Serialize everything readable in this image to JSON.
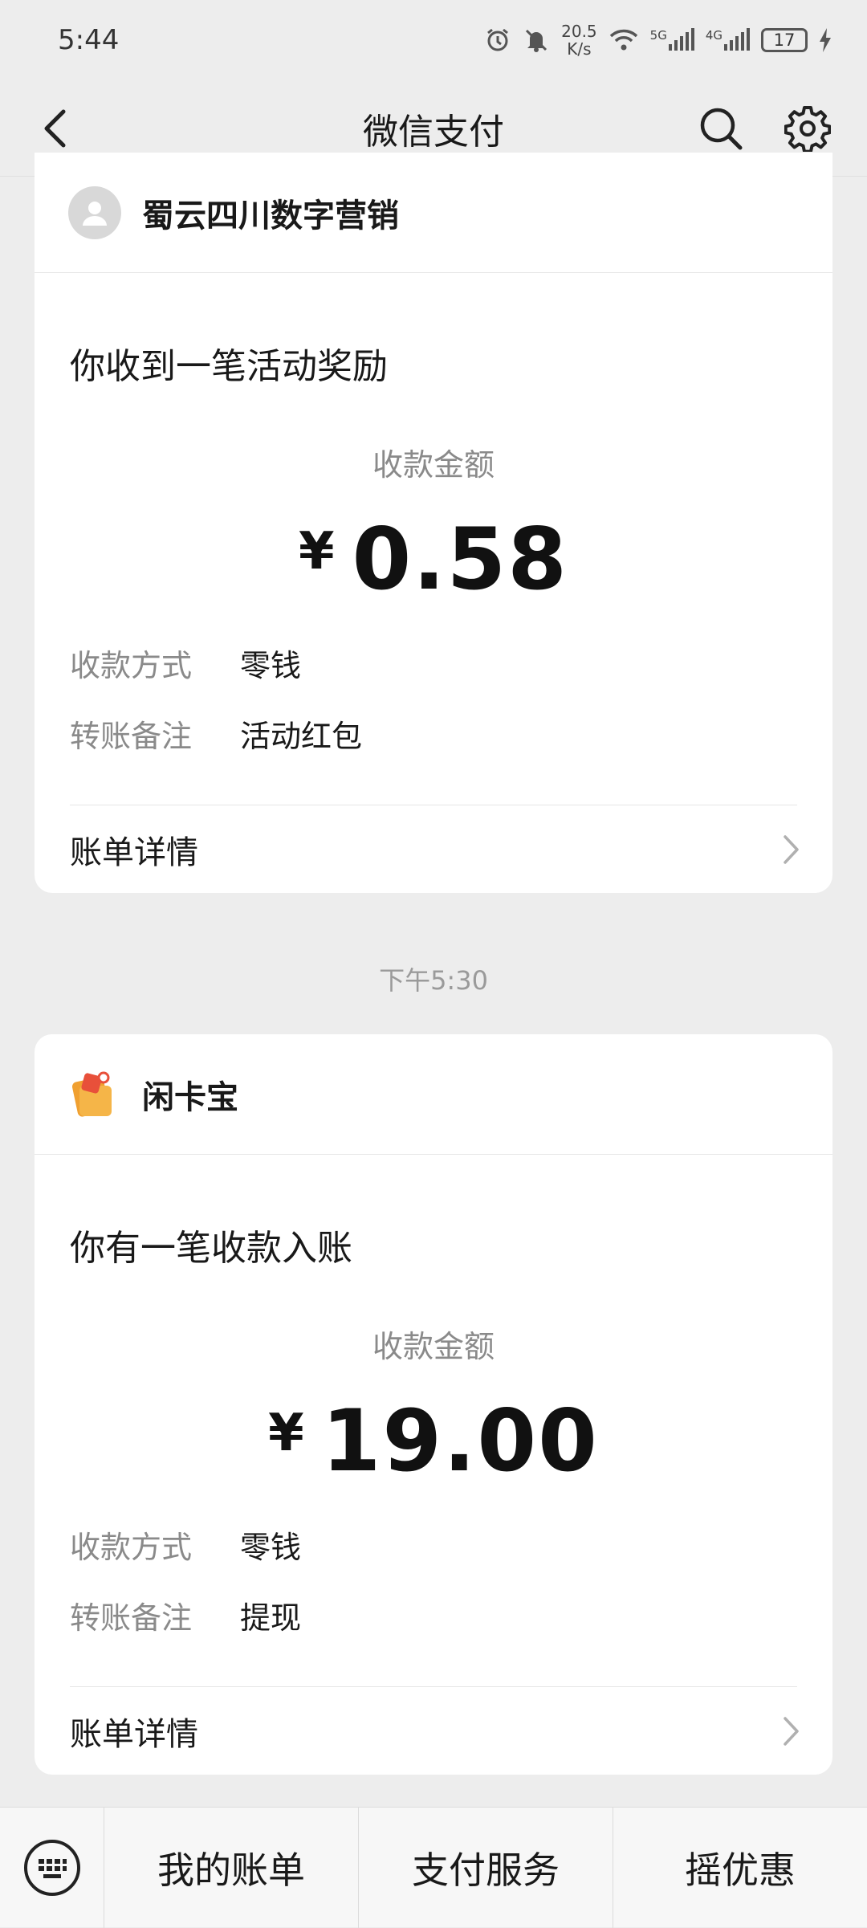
{
  "status_bar": {
    "time": "5:44",
    "net_speed_value": "20.5",
    "net_speed_unit": "K/s",
    "signal_1_label": "5G",
    "signal_2_label": "4G",
    "battery": "17"
  },
  "nav": {
    "title": "微信支付"
  },
  "cards": [
    {
      "merchant": "蜀云四川数字营销",
      "title": "你收到一笔活动奖励",
      "amount_label": "收款金额",
      "currency": "¥",
      "amount": "0.58",
      "method_key": "收款方式",
      "method_value": "零钱",
      "note_key": "转账备注",
      "note_value": "活动红包",
      "detail_label": "账单详情"
    },
    {
      "merchant": "闲卡宝",
      "title": "你有一笔收款入账",
      "amount_label": "收款金额",
      "currency": "¥",
      "amount": "19.00",
      "method_key": "收款方式",
      "method_value": "零钱",
      "note_key": "转账备注",
      "note_value": "提现",
      "detail_label": "账单详情"
    }
  ],
  "timestamp": "下午5:30",
  "bottom_menu": {
    "items": [
      "我的账单",
      "支付服务",
      "摇优惠"
    ]
  },
  "colors": {
    "background": "#ededed",
    "card": "#ffffff",
    "muted_text": "#8a8a8a",
    "logo_orange": "#f0a030",
    "logo_red": "#e8503a"
  }
}
